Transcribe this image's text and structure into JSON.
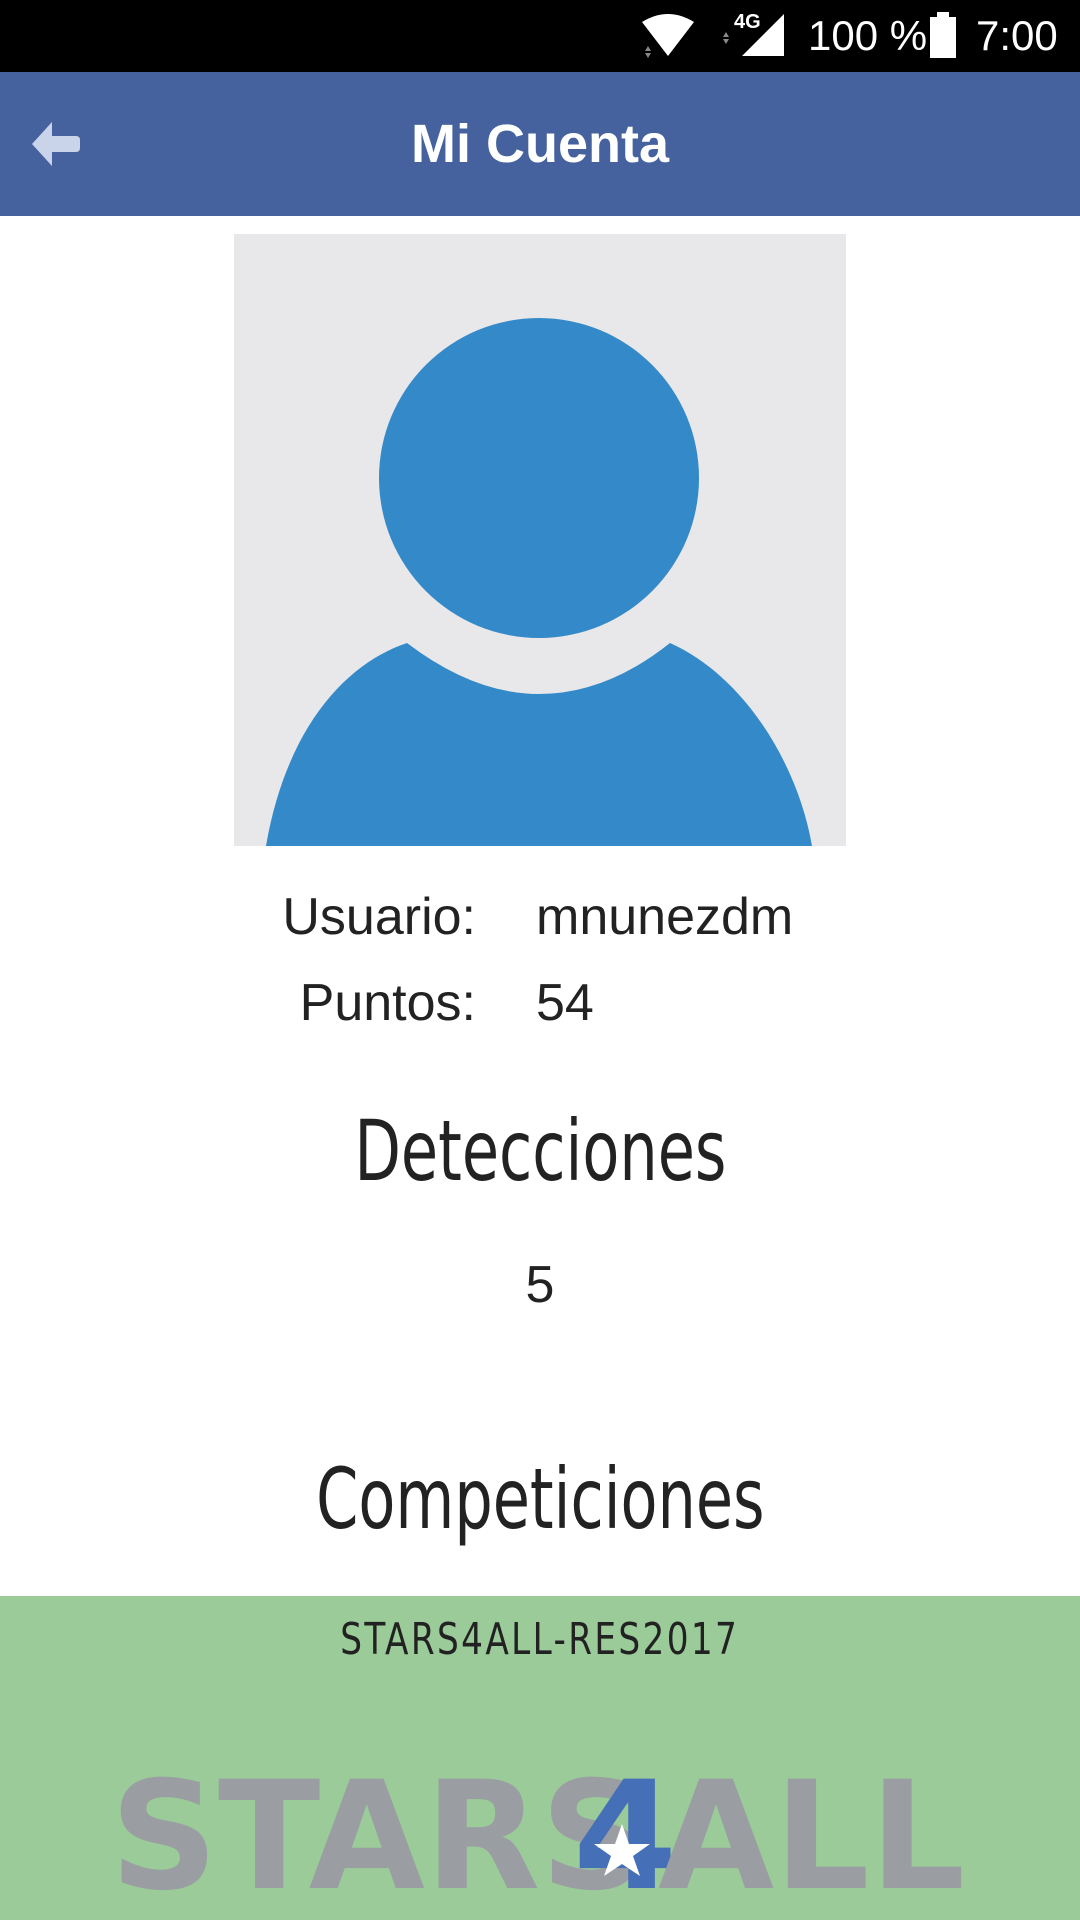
{
  "status_bar": {
    "network": "4G",
    "battery_percent": "100 %",
    "time": "7:00"
  },
  "app_bar": {
    "title": "Mi Cuenta",
    "back_icon": "arrow-left-icon",
    "color": "#45629e"
  },
  "profile": {
    "avatar_icon": "default-user-avatar",
    "avatar_color": "#3489c9",
    "user_label": "Usuario:",
    "user_value": "mnunezdm",
    "points_label": "Puntos:",
    "points_value": "54"
  },
  "detections": {
    "heading": "Detecciones",
    "count": "5"
  },
  "competitions": {
    "heading": "Competiciones",
    "items": [
      {
        "name": "STARS4ALL-RES2017",
        "logo_text": "STARS4ALL",
        "card_color": "#9acb98"
      }
    ]
  }
}
